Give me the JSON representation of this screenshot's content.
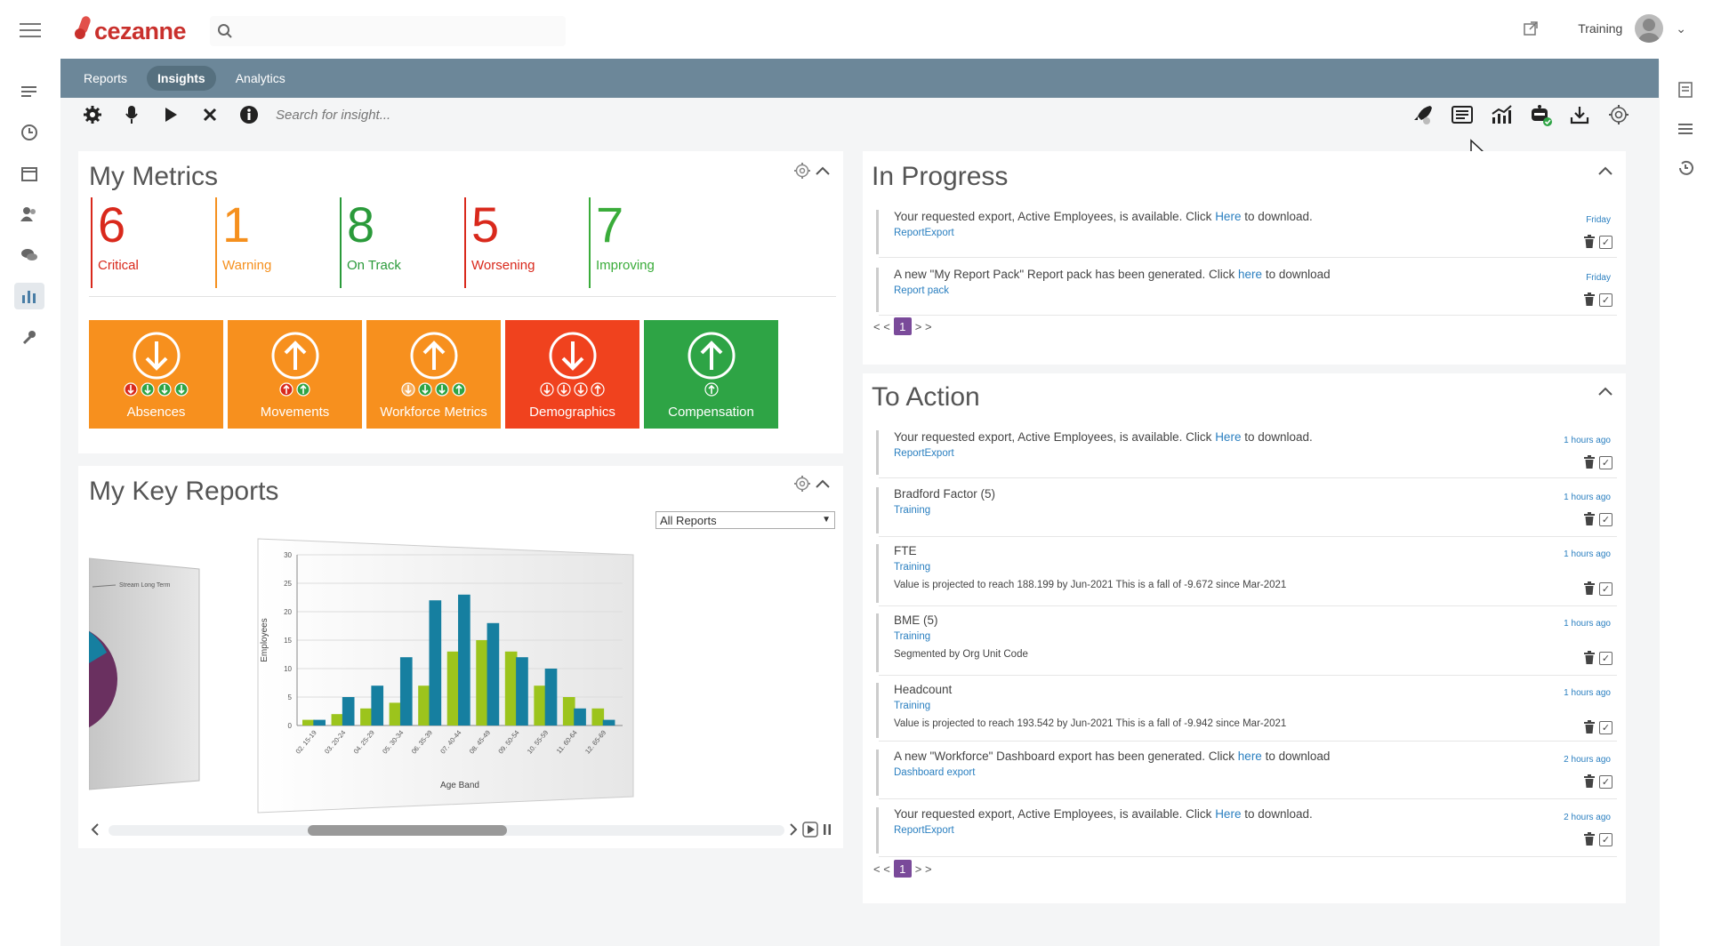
{
  "app": {
    "logo_text": "cezanne",
    "search_placeholder": "",
    "user_name": "Training"
  },
  "nav": {
    "tabs": [
      {
        "label": "Reports"
      },
      {
        "label": "Insights"
      },
      {
        "label": "Analytics"
      }
    ]
  },
  "toolbar": {
    "search_placeholder": "Search for insight..."
  },
  "metrics": {
    "title": "My Metrics",
    "items": [
      {
        "value": "6",
        "label": "Critical",
        "color": "#d9291c"
      },
      {
        "value": "1",
        "label": "Warning",
        "color": "#f5901e"
      },
      {
        "value": "8",
        "label": "On Track",
        "color": "#2a9a3a"
      },
      {
        "value": "5",
        "label": "Worsening",
        "color": "#d9291c"
      },
      {
        "value": "7",
        "label": "Improving",
        "color": "#3aac3a"
      }
    ],
    "tiles": [
      {
        "label": "Absences",
        "color": "#f7901e",
        "direction": "down"
      },
      {
        "label": "Movements",
        "color": "#f7901e",
        "direction": "up"
      },
      {
        "label": "Workforce Metrics",
        "color": "#f7901e",
        "direction": "up"
      },
      {
        "label": "Demographics",
        "color": "#f0421e",
        "direction": "down"
      },
      {
        "label": "Compensation",
        "color": "#2ea445",
        "direction": "up"
      }
    ]
  },
  "reports": {
    "title": "My Key Reports",
    "filter_selected": "All Reports",
    "side_card_legend": "Stream Long Term"
  },
  "chart_data": {
    "type": "bar",
    "xlabel": "Age Band",
    "ylabel": "Employees",
    "ylim": [
      0,
      30
    ],
    "yticks": [
      0,
      5,
      10,
      15,
      20,
      25,
      30
    ],
    "categories": [
      "02. 15-19",
      "03. 20-24",
      "04. 25-29",
      "05. 30-34",
      "06. 35-39",
      "07. 40-44",
      "08. 45-49",
      "09. 50-54",
      "10. 55-59",
      "11. 60-64",
      "12. 65-69"
    ],
    "series": [
      {
        "values": [
          1,
          2,
          3,
          4,
          7,
          13,
          15,
          13,
          7,
          5,
          3
        ],
        "color": "#9cc41c"
      },
      {
        "values": [
          1,
          5,
          7,
          12,
          22,
          23,
          18,
          12,
          10,
          3,
          1
        ],
        "color": "#167fa0"
      }
    ]
  },
  "in_progress": {
    "title": "In Progress",
    "items": [
      {
        "pre": "Your requested export, Active Employees, is available. Click ",
        "link": "Here",
        "post": " to download.",
        "category": "ReportExport",
        "detail": "",
        "time": "Friday"
      },
      {
        "pre": "A new \"My Report Pack\" Report pack has been generated. Click ",
        "link": "here",
        "post": " to download",
        "category": "Report pack",
        "detail": "",
        "time": "Friday"
      }
    ],
    "pager": {
      "prev": "< <",
      "page": "1",
      "next": "> >"
    }
  },
  "to_action": {
    "title": "To Action",
    "items": [
      {
        "pre": "Your requested export, Active Employees, is available. Click ",
        "link": "Here",
        "post": " to download.",
        "category": "ReportExport",
        "detail": "",
        "time": "1 hours ago"
      },
      {
        "pre": "Bradford Factor (5)",
        "link": "",
        "post": "",
        "category": "Training",
        "detail": "",
        "time": "1 hours ago"
      },
      {
        "pre": "FTE",
        "link": "",
        "post": "",
        "category": "Training",
        "detail": "Value is projected to reach 188.199 by Jun-2021 This is a fall of -9.672 since Mar-2021",
        "time": "1 hours ago"
      },
      {
        "pre": "BME (5)",
        "link": "",
        "post": "",
        "category": "Training",
        "detail": "Segmented by Org Unit Code",
        "time": "1 hours ago"
      },
      {
        "pre": "Headcount",
        "link": "",
        "post": "",
        "category": "Training",
        "detail": "Value is projected to reach 193.542 by Jun-2021 This is a fall of -9.942 since Mar-2021",
        "time": "1 hours ago"
      },
      {
        "pre": "A new \"Workforce\" Dashboard export has been generated. Click ",
        "link": "here",
        "post": " to download",
        "category": "Dashboard export",
        "detail": "",
        "time": "2 hours ago"
      },
      {
        "pre": "Your requested export, Active Employees, is available. Click ",
        "link": "Here",
        "post": " to download.",
        "category": "ReportExport",
        "detail": "",
        "time": "2 hours ago"
      }
    ],
    "pager": {
      "prev": "< <",
      "page": "1",
      "next": "> >"
    }
  }
}
